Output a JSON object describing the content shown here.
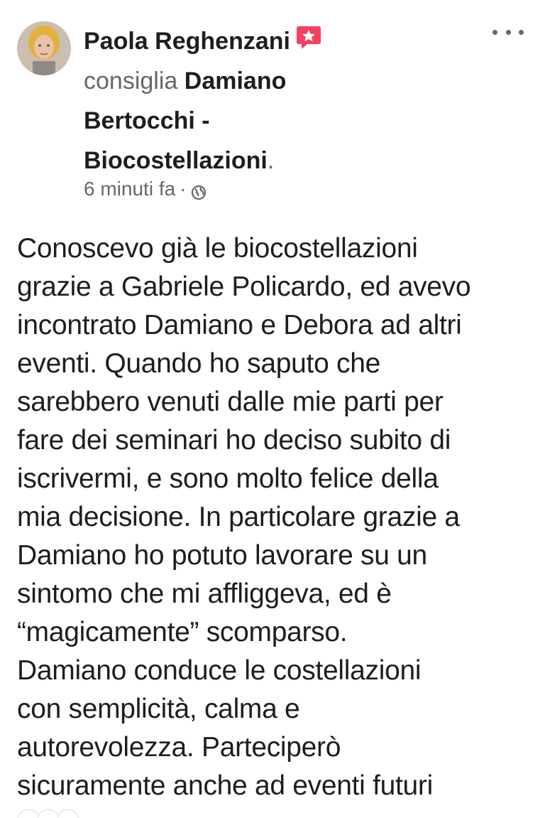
{
  "post": {
    "author": "Paola Reghenzani",
    "verb": "consiglia",
    "page_name_line1": "Damiano",
    "page_name_line2": "Bertocchi -",
    "page_name_line3": "Biocostellazioni",
    "period": ".",
    "timestamp": "6 minuti fa",
    "separator": "·",
    "privacy_icon": "globe-icon",
    "badge_icon": "recommend-star-icon",
    "more_icon": "more-options-icon",
    "body_lines": [
      "Conoscevo già le biocostellazioni",
      "grazie a Gabriele Policardo, ed avevo",
      "incontrato Damiano e Debora ad altri",
      "eventi. Quando ho saputo che",
      "sarebbero venuti dalle mie parti per",
      "fare dei seminari ho deciso subito di",
      "iscrivermi, e sono molto felice della",
      "mia decisione. In particolare grazie a",
      "Damiano ho potuto lavorare su un",
      "sintomo che mi affliggeva, ed è",
      "“magicamente” scomparso.",
      "Damiano conduce le costellazioni",
      "con semplicità, calma e",
      "autorevolezza. Parteciperò",
      "sicuramente anche ad eventi futuri"
    ]
  },
  "colors": {
    "text_primary": "#1c1e21",
    "text_secondary": "#65676b",
    "badge": "#f3425f"
  }
}
